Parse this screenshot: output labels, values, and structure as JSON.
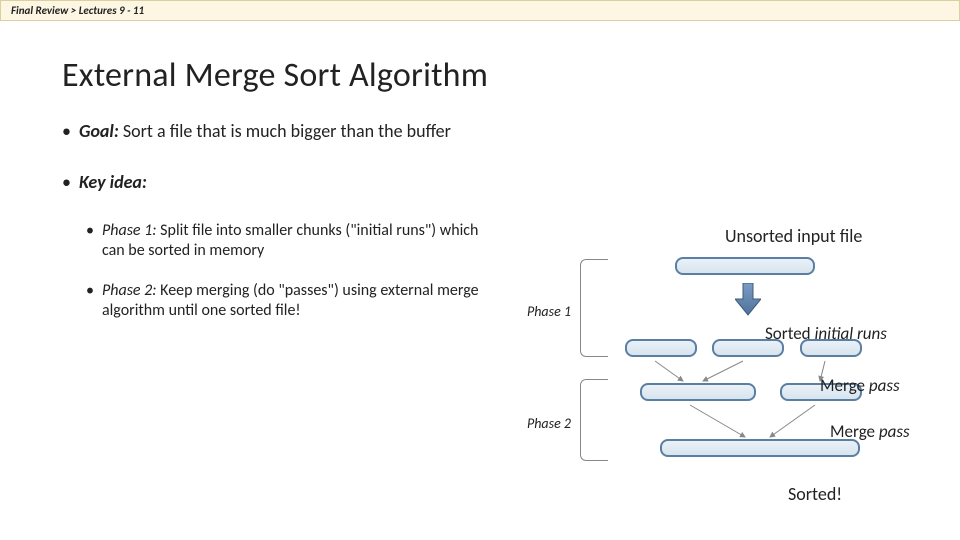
{
  "breadcrumb": "Final Review  >  Lectures 9 - 11",
  "title": "External Merge Sort Algorithm",
  "goal_label": "Goal:",
  "goal_text": " Sort a file that is much bigger than the buffer",
  "keyidea_label": "Key idea:",
  "phase1_label": "Phase 1:",
  "phase1_text": " Split file into smaller chunks (\"initial runs\") which can be sorted in memory",
  "phase2_label": "Phase 2:",
  "phase2_text": " Keep merging (do \"passes\") using external merge algorithm until one sorted file!",
  "diagram": {
    "unsorted": "Unsorted input file",
    "phase1": "Phase 1",
    "phase2": "Phase 2",
    "sorted_runs_pre": "Sorted ",
    "sorted_runs_it": "initial runs",
    "merge_pre": "Merge ",
    "merge_it": "pass",
    "sorted": "Sorted!"
  }
}
